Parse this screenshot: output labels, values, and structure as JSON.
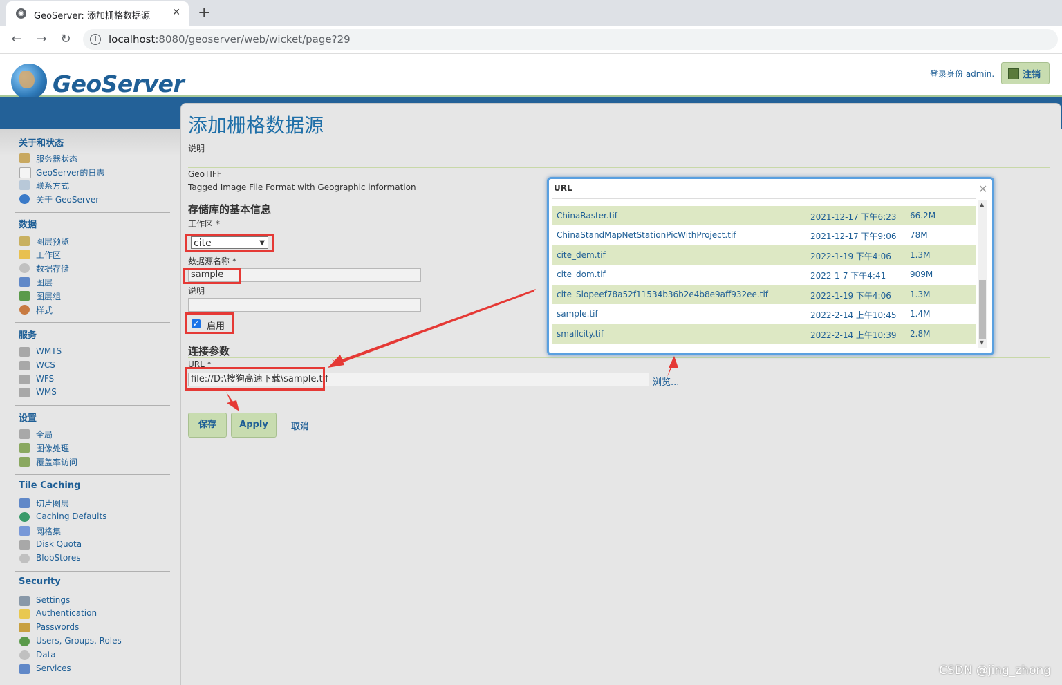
{
  "browser": {
    "tab_title": "GeoServer: 添加栅格数据源",
    "url_host": "localhost",
    "url_rest": ":8080/geoserver/web/wicket/page?29"
  },
  "header": {
    "logo_text": "GeoServer",
    "login_info": "登录身份 admin.",
    "logout_label": "注销"
  },
  "sidebar": {
    "sections": [
      {
        "title": "关于和状态",
        "items": [
          "服务器状态",
          "GeoServer的日志",
          "联系方式",
          "关于 GeoServer"
        ]
      },
      {
        "title": "数据",
        "items": [
          "图层预览",
          "工作区",
          "数据存储",
          "图层",
          "图层组",
          "样式"
        ]
      },
      {
        "title": "服务",
        "items": [
          "WMTS",
          "WCS",
          "WFS",
          "WMS"
        ]
      },
      {
        "title": "设置",
        "items": [
          "全局",
          "图像处理",
          "覆盖率访问"
        ]
      },
      {
        "title": "Tile Caching",
        "items": [
          "切片图层",
          "Caching Defaults",
          "网格集",
          "Disk Quota",
          "BlobStores"
        ]
      },
      {
        "title": "Security",
        "items": [
          "Settings",
          "Authentication",
          "Passwords",
          "Users, Groups, Roles",
          "Data",
          "Services"
        ]
      }
    ]
  },
  "main": {
    "title": "添加栅格数据源",
    "description": "说明",
    "format_name": "GeoTIFF",
    "format_desc": "Tagged Image File Format with Geographic information",
    "basic_info_heading": "存储库的基本信息",
    "workspace_label": "工作区 *",
    "workspace_value": "cite",
    "name_label": "数据源名称 *",
    "name_value": "sample",
    "desc_label": "说明",
    "desc_value": "",
    "enabled_label": "启用",
    "conn_heading": "连接参数",
    "url_label": "URL *",
    "url_value": "file://D:\\搜狗高速下载\\sample.tif",
    "browse_label": "浏览...",
    "save_label": "保存",
    "apply_label": "Apply",
    "cancel_label": "取消"
  },
  "file_chooser": {
    "title": "URL",
    "files": [
      {
        "name": "ChinaRaster.tif",
        "date": "2021-12-17 下午6:23",
        "size": "66.2M"
      },
      {
        "name": "ChinaStandMapNetStationPicWithProject.tif",
        "date": "2021-12-17 下午9:06",
        "size": "78M"
      },
      {
        "name": "cite_dem.tif",
        "date": "2022-1-19 下午4:06",
        "size": "1.3M"
      },
      {
        "name": "cite_dom.tif",
        "date": "2022-1-7 下午4:41",
        "size": "909M"
      },
      {
        "name": "cite_Slopeef78a52f11534b36b2e4b8e9aff932ee.tif",
        "date": "2022-1-19 下午4:06",
        "size": "1.3M"
      },
      {
        "name": "sample.tif",
        "date": "2022-2-14 上午10:45",
        "size": "1.4M"
      },
      {
        "name": "smallcity.tif",
        "date": "2022-2-14 上午10:39",
        "size": "2.8M"
      }
    ]
  },
  "watermark": "CSDN @jing_zhong",
  "colors": {
    "accent": "#1f5f96",
    "highlight": "#e53935",
    "row_alt": "#dde8c4"
  }
}
